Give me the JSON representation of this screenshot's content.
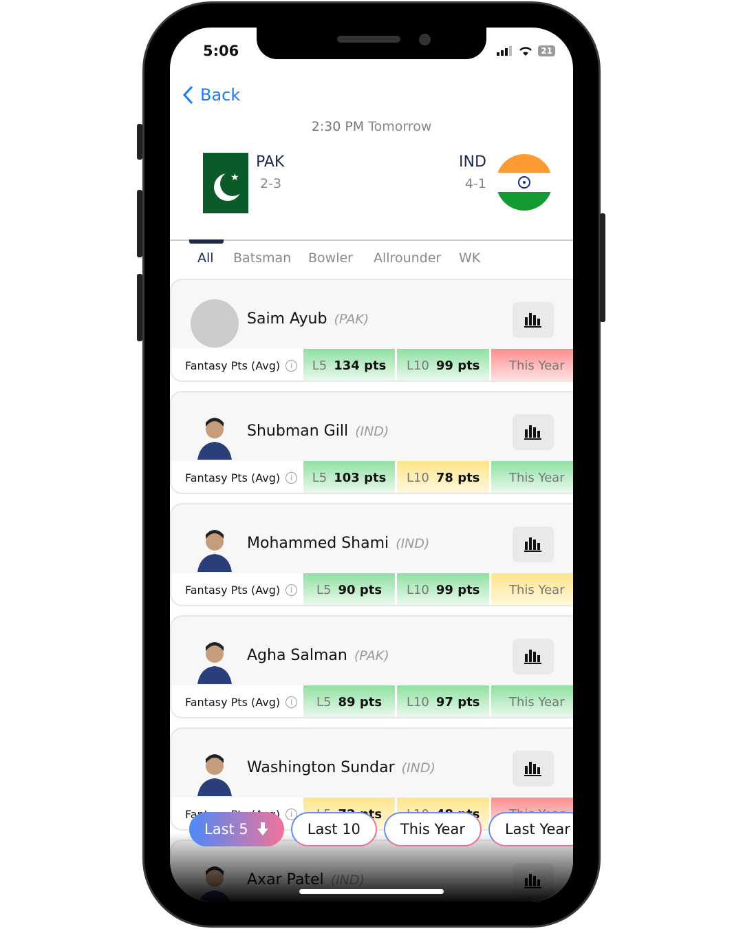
{
  "status": {
    "time": "5:06",
    "battery": "21"
  },
  "nav": {
    "back": "Back"
  },
  "match": {
    "time": "2:30 PM",
    "day": "Tomorrow",
    "home": {
      "code": "PAK",
      "record": "2-3"
    },
    "away": {
      "code": "IND",
      "record": "4-1"
    }
  },
  "tabs": [
    "All",
    "Batsman",
    "Bowler",
    "Allrounder",
    "WK"
  ],
  "stat_label": "Fantasy Pts (Avg)",
  "colors": {
    "green": "#8fe0a2",
    "yellow": "#fde58a",
    "red": "#fc8e8e",
    "accent": "#1a7cf5"
  },
  "players": [
    {
      "name": "Saim Ayub",
      "team": "(PAK)",
      "l5_label": "L5",
      "l5": "134 pts",
      "l10_label": "L10",
      "l10": "99 pts",
      "ty": "This Year",
      "c": [
        "g",
        "g",
        "r"
      ]
    },
    {
      "name": "Shubman Gill",
      "team": "(IND)",
      "l5_label": "L5",
      "l5": "103 pts",
      "l10_label": "L10",
      "l10": "78 pts",
      "ty": "This Year",
      "c": [
        "g",
        "y",
        "g"
      ]
    },
    {
      "name": "Mohammed Shami",
      "team": "(IND)",
      "l5_label": "L5",
      "l5": "90 pts",
      "l10_label": "L10",
      "l10": "99 pts",
      "ty": "This Year",
      "c": [
        "g",
        "g",
        "y"
      ]
    },
    {
      "name": "Agha Salman",
      "team": "(PAK)",
      "l5_label": "L5",
      "l5": "89 pts",
      "l10_label": "L10",
      "l10": "97 pts",
      "ty": "This Year",
      "c": [
        "g",
        "g",
        "g"
      ]
    },
    {
      "name": "Washington Sundar",
      "team": "(IND)",
      "l5_label": "L5",
      "l5": "72 pts",
      "l10_label": "L10",
      "l10": "48 pts",
      "ty": "This Year",
      "c": [
        "y",
        "y",
        "r"
      ]
    },
    {
      "name": "Axar Patel",
      "team": "(IND)",
      "l5_label": "",
      "l5": "",
      "l10_label": "",
      "l10": "",
      "ty": "",
      "c": [
        "g",
        "g",
        "g"
      ]
    }
  ],
  "filters": [
    {
      "label": "Last 5",
      "active": true
    },
    {
      "label": "Last 10"
    },
    {
      "label": "This Year"
    },
    {
      "label": "Last Year"
    }
  ]
}
